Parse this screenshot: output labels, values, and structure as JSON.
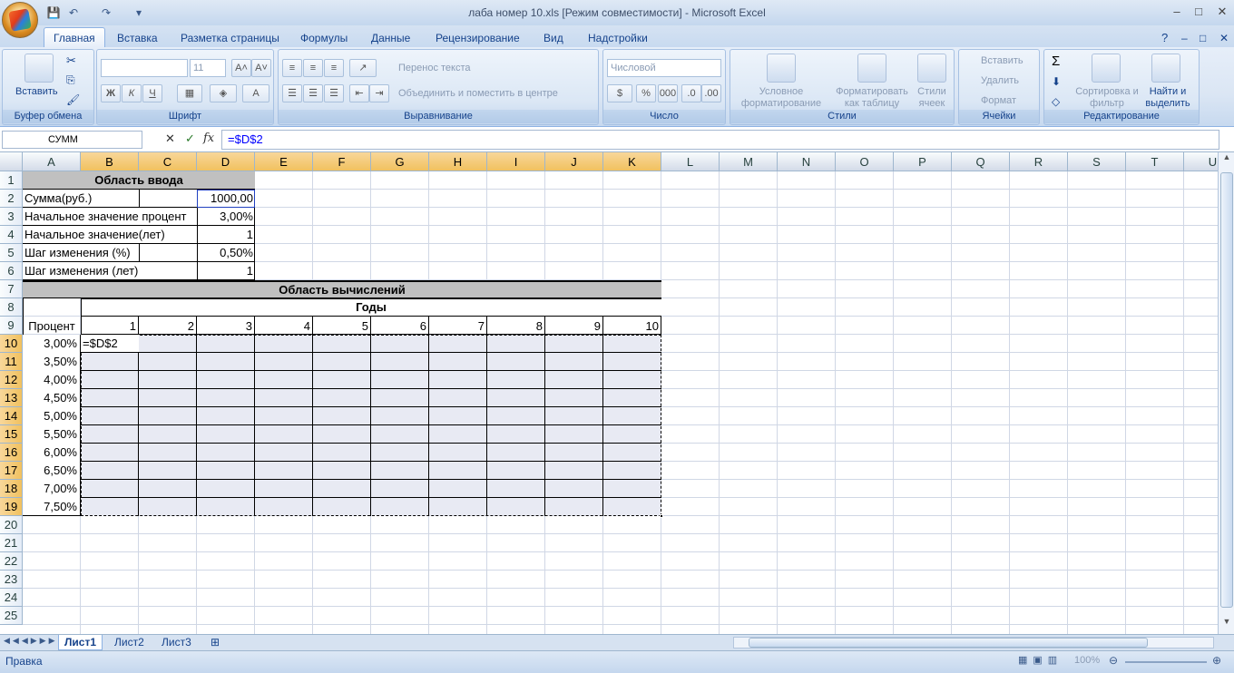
{
  "window": {
    "title": "лаба номер 10.xls  [Режим совместимости] - Microsoft Excel",
    "min": "–",
    "max": "□",
    "close": "✕"
  },
  "ribbon_tabs": [
    "Главная",
    "Вставка",
    "Разметка страницы",
    "Формулы",
    "Данные",
    "Рецензирование",
    "Вид",
    "Надстройки"
  ],
  "ribbon": {
    "clipboard": {
      "label": "Буфер обмена",
      "paste": "Вставить"
    },
    "font": {
      "label": "Шрифт",
      "size": "11",
      "bold": "Ж",
      "italic": "К",
      "underline": "Ч"
    },
    "alignment": {
      "label": "Выравнивание",
      "wrap": "Перенос текста",
      "merge": "Объединить и поместить в центре"
    },
    "number": {
      "label": "Число",
      "format": "Числовой",
      "percent": "%",
      "thousands": "000"
    },
    "styles": {
      "label": "Стили",
      "conditional": "Условное форматирование",
      "as_table": "Форматировать как таблицу",
      "cell_styles": "Стили ячеек"
    },
    "cells": {
      "label": "Ячейки",
      "insert": "Вставить",
      "delete": "Удалить",
      "format": "Формат"
    },
    "editing": {
      "label": "Редактирование",
      "sort": "Сортировка и фильтр",
      "find": "Найти и выделить",
      "sum": "Σ"
    }
  },
  "formula_bar": {
    "name_box": "СУММ",
    "cancel": "✕",
    "enter": "✓",
    "fx": "fx",
    "formula": "=$D$2"
  },
  "columns": [
    "A",
    "B",
    "C",
    "D",
    "E",
    "F",
    "G",
    "H",
    "I",
    "J",
    "K",
    "L",
    "M",
    "N",
    "O",
    "P",
    "Q",
    "R",
    "S",
    "T",
    "U"
  ],
  "rows": [
    "1",
    "2",
    "3",
    "4",
    "5",
    "6",
    "7",
    "8",
    "9",
    "10",
    "11",
    "12",
    "13",
    "14",
    "15",
    "16",
    "17",
    "18",
    "19",
    "20",
    "21",
    "22",
    "23",
    "24",
    "25"
  ],
  "cells": {
    "input_title": "Область ввода",
    "sum_label": "Сумма(руб.)",
    "sum_value": "1000,00",
    "rate_start_label": "Начальное значение процент",
    "rate_start_value": "3,00%",
    "years_start_label": "Начальное значение(лет)",
    "years_start_value": "1",
    "rate_step_label": "Шаг изменения (%)",
    "rate_step_value": "0,50%",
    "years_step_label": "Шаг изменения (лет)",
    "years_step_value": "1",
    "calc_title": "Область вычислений",
    "years_header": "Годы",
    "percent_header": "Процент",
    "years": [
      "1",
      "2",
      "3",
      "4",
      "5",
      "6",
      "7",
      "8",
      "9",
      "10"
    ],
    "percents": [
      "3,00%",
      "3,50%",
      "4,00%",
      "4,50%",
      "5,00%",
      "5,50%",
      "6,00%",
      "6,50%",
      "7,00%",
      "7,50%"
    ],
    "editing_formula": "=$D$2"
  },
  "sheets": [
    "Лист1",
    "Лист2",
    "Лист3"
  ],
  "status": {
    "mode": "Правка",
    "zoom": "100%"
  }
}
